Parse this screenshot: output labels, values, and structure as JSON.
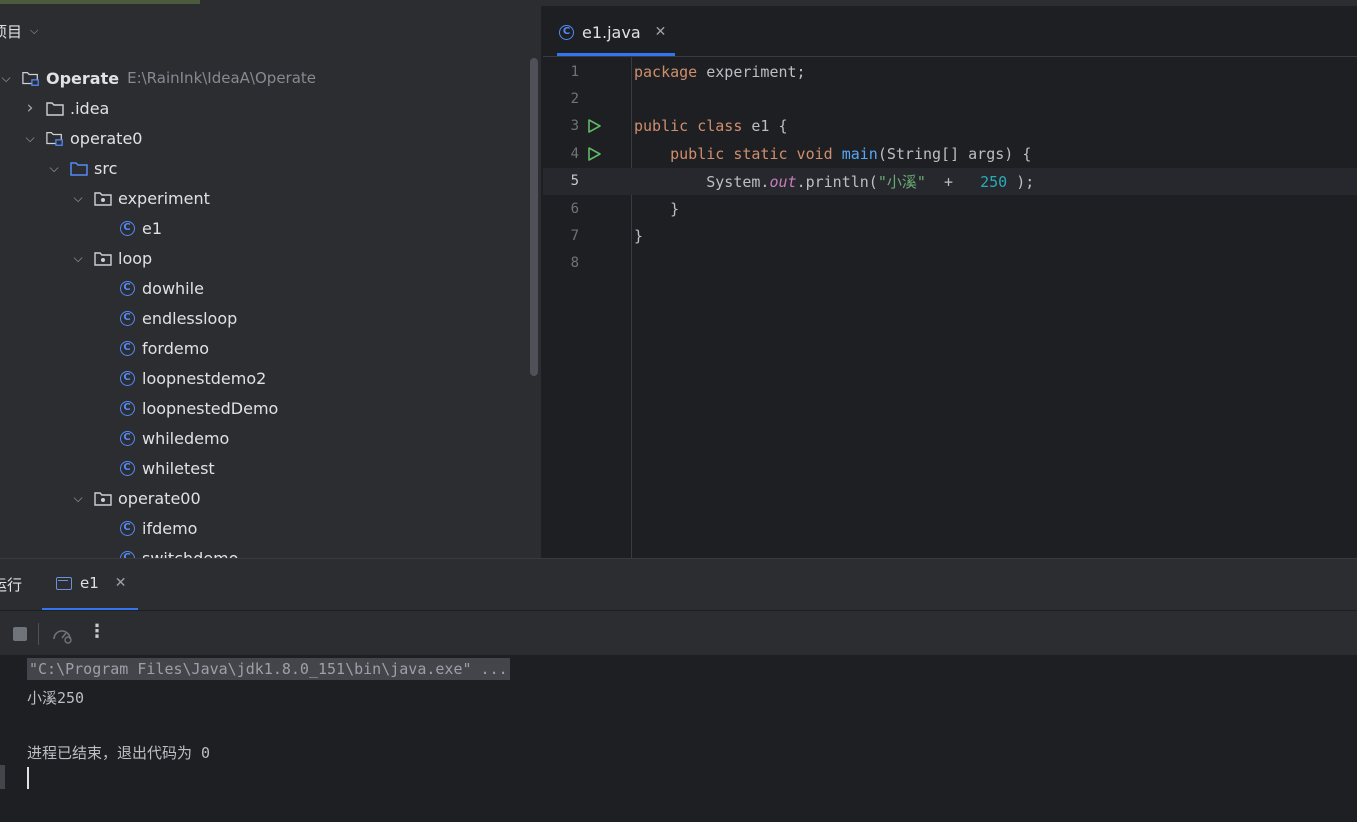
{
  "project": {
    "header_title": "项目",
    "tree": [
      {
        "label": "Operate",
        "path": "E:\\RainInk\\IdeaA\\Operate",
        "icon": "module-folder-icon",
        "expanded": true,
        "depth": 0,
        "bold": true
      },
      {
        "label": ".idea",
        "icon": "folder-icon",
        "expanded": false,
        "depth": 1
      },
      {
        "label": "operate0",
        "icon": "module-folder-icon",
        "expanded": true,
        "depth": 1
      },
      {
        "label": "src",
        "icon": "source-folder-icon",
        "expanded": true,
        "depth": 2
      },
      {
        "label": "experiment",
        "icon": "package-icon",
        "expanded": true,
        "depth": 3
      },
      {
        "label": "e1",
        "icon": "class-icon",
        "depth": 4
      },
      {
        "label": "loop",
        "icon": "package-icon",
        "expanded": true,
        "depth": 3
      },
      {
        "label": "dowhile",
        "icon": "class-icon",
        "depth": 4
      },
      {
        "label": "endlessloop",
        "icon": "class-icon",
        "depth": 4
      },
      {
        "label": "fordemo",
        "icon": "class-icon",
        "depth": 4
      },
      {
        "label": "loopnestdemo2",
        "icon": "class-icon",
        "depth": 4
      },
      {
        "label": "loopnestedDemo",
        "icon": "class-icon",
        "depth": 4
      },
      {
        "label": "whiledemo",
        "icon": "class-icon",
        "depth": 4
      },
      {
        "label": "whiletest",
        "icon": "class-icon",
        "depth": 4
      },
      {
        "label": "operate00",
        "icon": "package-icon",
        "expanded": true,
        "depth": 3
      },
      {
        "label": "ifdemo",
        "icon": "class-icon",
        "depth": 4
      },
      {
        "label": "switchdemo",
        "icon": "class-icon",
        "depth": 4
      }
    ]
  },
  "editor": {
    "tab_label": "e1.java",
    "current_line": 5,
    "lines": [
      {
        "num": "1",
        "run": false,
        "tokens": [
          [
            "kw",
            "package"
          ],
          [
            "pl",
            " experiment;"
          ]
        ]
      },
      {
        "num": "2",
        "run": false,
        "tokens": []
      },
      {
        "num": "3",
        "run": true,
        "tokens": [
          [
            "kw",
            "public class"
          ],
          [
            "pl",
            " e1 {"
          ]
        ]
      },
      {
        "num": "4",
        "run": true,
        "tokens": [
          [
            "pl",
            "    "
          ],
          [
            "kw",
            "public static void"
          ],
          [
            "pl",
            " "
          ],
          [
            "fn",
            "main"
          ],
          [
            "pl",
            "(String[] args) {"
          ]
        ]
      },
      {
        "num": "5",
        "run": false,
        "tokens": [
          [
            "pl",
            "        System."
          ],
          [
            "it",
            "out"
          ],
          [
            "pl",
            ".println("
          ],
          [
            "st",
            "\"小溪\""
          ],
          [
            "pl",
            "  +   "
          ],
          [
            "nu",
            "250"
          ],
          [
            "pl",
            " );"
          ]
        ]
      },
      {
        "num": "6",
        "run": false,
        "tokens": [
          [
            "pl",
            "    }"
          ]
        ]
      },
      {
        "num": "7",
        "run": false,
        "tokens": [
          [
            "pl",
            "}"
          ]
        ]
      },
      {
        "num": "8",
        "run": false,
        "tokens": []
      }
    ]
  },
  "run": {
    "window_label": "运行",
    "tab_label": "e1",
    "console": {
      "command": "\"C:\\Program Files\\Java\\jdk1.8.0_151\\bin\\java.exe\" ...",
      "output": "小溪250",
      "exit_message": "进程已结束，退出代码为 0"
    }
  },
  "colors": {
    "accent": "#3574f0",
    "keyword": "#cf8e6d",
    "function": "#56a8f5",
    "string": "#6aab73",
    "number": "#2aacb8",
    "static_field": "#c77dbb",
    "run_gutter": "#5fb865",
    "class_icon": "#548af7"
  }
}
